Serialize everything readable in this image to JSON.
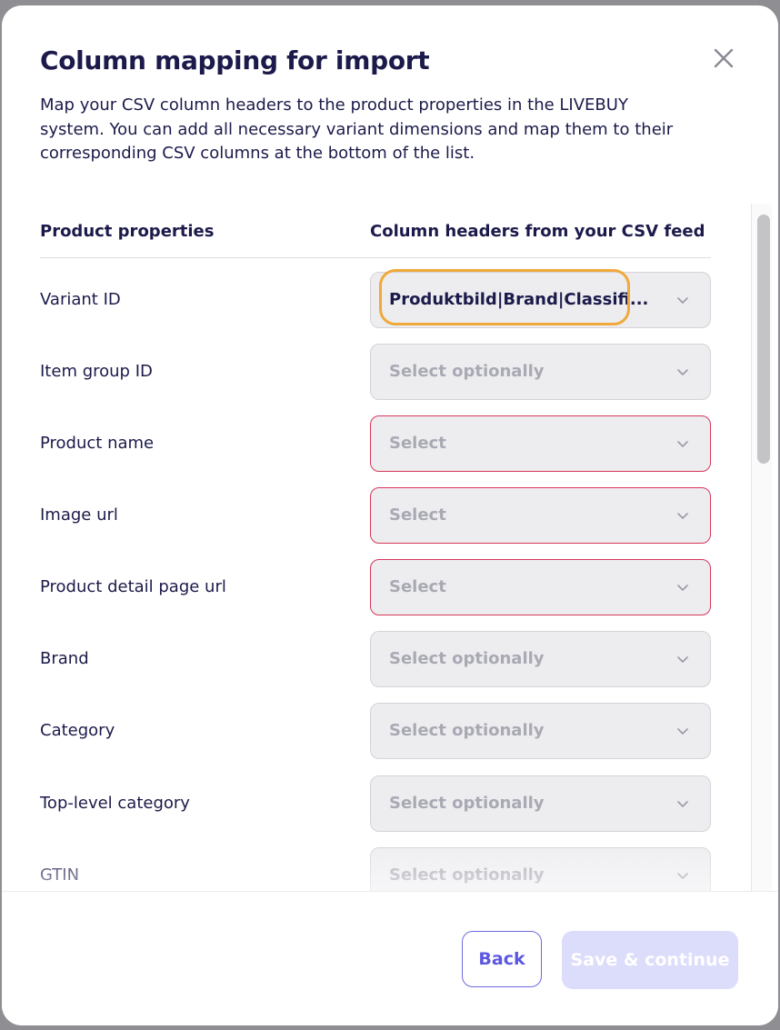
{
  "modal": {
    "title": "Column mapping for import",
    "description": "Map your CSV column headers to the product properties in the LIVEBUY system. You can add all necessary variant dimensions and map them to their corresponding CSV columns at the bottom of the list.",
    "close_icon": "close-icon"
  },
  "table": {
    "header_left": "Product properties",
    "header_right": "Column headers from your CSV feed",
    "rows": [
      {
        "label": "Variant ID",
        "value": "Produktbild|Brand|Classifi...",
        "state": "filled-focused"
      },
      {
        "label": "Item group ID",
        "value": "Select optionally",
        "state": "optional"
      },
      {
        "label": "Product name",
        "value": "Select",
        "state": "required-error"
      },
      {
        "label": "Image url",
        "value": "Select",
        "state": "required-error"
      },
      {
        "label": "Product detail page url",
        "value": "Select",
        "state": "required-error"
      },
      {
        "label": "Brand",
        "value": "Select optionally",
        "state": "optional"
      },
      {
        "label": "Category",
        "value": "Select optionally",
        "state": "optional"
      },
      {
        "label": "Top-level category",
        "value": "Select optionally",
        "state": "optional"
      },
      {
        "label": "GTIN",
        "value": "Select optionally",
        "state": "optional"
      }
    ],
    "chevron_icon": "chevron-down-icon"
  },
  "footer": {
    "back_label": "Back",
    "save_label": "Save & continue",
    "save_disabled": true
  },
  "colors": {
    "text": "#1b1a4a",
    "placeholder": "#a9a9b4",
    "error_border": "#d8375a",
    "focus_ring": "#f0a93b",
    "accent": "#5c57e0",
    "disabled_button": "#dcdcfb"
  }
}
